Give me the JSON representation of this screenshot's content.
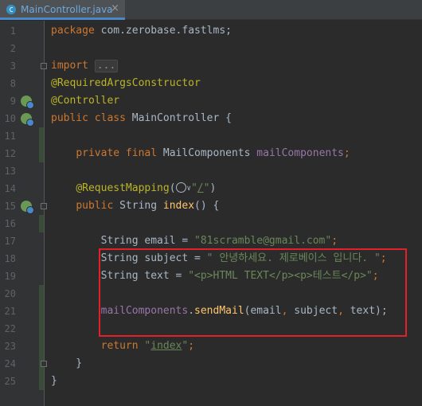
{
  "tab": {
    "title": "MainController.java",
    "close": "×"
  },
  "lines": [
    {
      "n": "1",
      "tokens": [
        [
          "kw",
          "package "
        ],
        [
          "pl",
          "com.zerobase.fastlms;"
        ]
      ]
    },
    {
      "n": "2",
      "tokens": []
    },
    {
      "n": "3",
      "tokens": [
        [
          "kw",
          "import "
        ],
        [
          "fold",
          "..."
        ]
      ]
    },
    {
      "n": "8",
      "tokens": [
        [
          "ann",
          "@RequiredArgsConstructor"
        ]
      ]
    },
    {
      "n": "9",
      "tokens": [
        [
          "ann",
          "@Controller"
        ]
      ]
    },
    {
      "n": "10",
      "tokens": [
        [
          "kw",
          "public class "
        ],
        [
          "pl",
          "MainController {"
        ]
      ]
    },
    {
      "n": "11",
      "tokens": []
    },
    {
      "n": "12",
      "tokens": [
        [
          "pl",
          "    "
        ],
        [
          "kw",
          "private final "
        ],
        [
          "pl",
          "MailComponents "
        ],
        [
          "fld",
          "mailComponents"
        ],
        [
          "kw",
          ";"
        ]
      ]
    },
    {
      "n": "13",
      "tokens": []
    },
    {
      "n": "14",
      "tokens": [
        [
          "pl",
          "    "
        ],
        [
          "ann",
          "@RequestMapping"
        ],
        [
          "pl",
          "("
        ],
        [
          "icon",
          ""
        ],
        [
          "str",
          "\""
        ],
        [
          "url",
          "/"
        ],
        [
          "str",
          "\""
        ],
        [
          "pl",
          ")"
        ]
      ]
    },
    {
      "n": "15",
      "tokens": [
        [
          "pl",
          "    "
        ],
        [
          "kw",
          "public "
        ],
        [
          "pl",
          "String "
        ],
        [
          "fn",
          "index"
        ],
        [
          "pl",
          "() {"
        ]
      ]
    },
    {
      "n": "16",
      "tokens": []
    },
    {
      "n": "17",
      "tokens": [
        [
          "pl",
          "        String email = "
        ],
        [
          "str",
          "\"81scramble@gmail.com\""
        ],
        [
          "kw",
          ";"
        ]
      ]
    },
    {
      "n": "18",
      "tokens": [
        [
          "pl",
          "        String subject = "
        ],
        [
          "str",
          "\" 안녕하세요. 제로베이스 입니다. \""
        ],
        [
          "kw",
          ";"
        ]
      ]
    },
    {
      "n": "19",
      "tokens": [
        [
          "pl",
          "        String text = "
        ],
        [
          "str",
          "\"<p>HTML TEXT</p><p>테스트</p>\""
        ],
        [
          "kw",
          ";"
        ]
      ]
    },
    {
      "n": "20",
      "tokens": []
    },
    {
      "n": "21",
      "tokens": [
        [
          "pl",
          "        "
        ],
        [
          "fld",
          "mailComponents"
        ],
        [
          "pl",
          "."
        ],
        [
          "fn",
          "sendMail"
        ],
        [
          "pl",
          "(email"
        ],
        [
          "kw",
          ", "
        ],
        [
          "pl",
          "subject"
        ],
        [
          "kw",
          ", "
        ],
        [
          "pl",
          "text);"
        ]
      ]
    },
    {
      "n": "22",
      "tokens": []
    },
    {
      "n": "23",
      "tokens": [
        [
          "pl",
          "        "
        ],
        [
          "kw",
          "return "
        ],
        [
          "str",
          "\""
        ],
        [
          "urlstr",
          "index"
        ],
        [
          "str",
          "\""
        ],
        [
          "kw",
          ";"
        ]
      ]
    },
    {
      "n": "24",
      "tokens": [
        [
          "pl",
          "    }"
        ]
      ]
    },
    {
      "n": "25",
      "tokens": [
        [
          "pl",
          "}"
        ]
      ]
    }
  ],
  "gutter_icons": [
    "spring-bean-icon",
    "spring-bean-icon",
    "spring-web-icon",
    "spring-web-icon"
  ],
  "colors": {
    "background": "#2b2b2b",
    "keyword": "#cc7832",
    "annotation": "#bbb529",
    "string": "#6a8759",
    "field": "#9876aa",
    "method": "#ffc66d",
    "plain": "#a9b7c6",
    "highlight_box": "#e3202a"
  }
}
